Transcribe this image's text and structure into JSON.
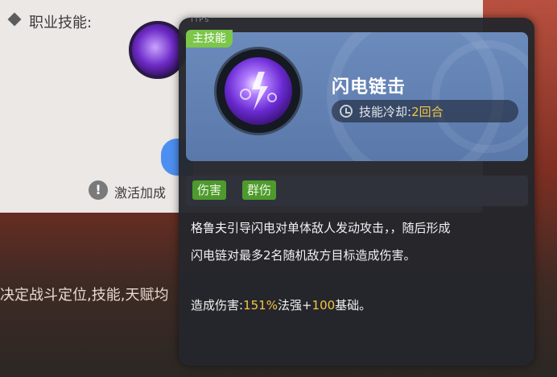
{
  "background": {
    "section_label": "职业技能:",
    "info_text": "激活加成",
    "bottom_text": "决定战斗定位,技能,天赋均"
  },
  "tooltip": {
    "tips_label": "TIPS",
    "badge": "主技能",
    "skill_name": "闪电链击",
    "cooldown_label": "技能冷却:",
    "cooldown_value": "2回合",
    "tags": [
      "伤害",
      "群伤"
    ],
    "description_line1": "格鲁夫引导闪电对单体敌人发动攻击，，随后形成",
    "description_line2": "闪电链对最多2名随机敌方目标造成伤害。",
    "damage_label": "造成伤害:",
    "damage_percent": "151%",
    "damage_stat": "法强+",
    "damage_base": "100",
    "damage_suffix": "基础。"
  },
  "colors": {
    "header_blue": "#6c8bbd",
    "badge_green": "#7cc64a",
    "tag_green": "#4e9a2d",
    "highlight_gold": "#f3c545",
    "tooltip_bg": "#24262c"
  },
  "icons": {
    "skill": "lightning-chain-icon",
    "cooldown": "clock-icon",
    "info": "exclamation-icon"
  }
}
